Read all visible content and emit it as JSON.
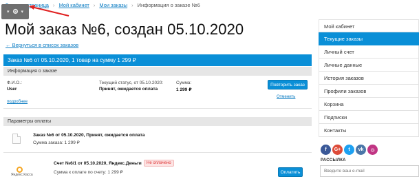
{
  "toolbar": {
    "gear_icon": "gear-icon",
    "caret": "▾"
  },
  "breadcrumb": {
    "items": [
      "Главная страница",
      "Мой кабинет",
      "Мои заказы",
      "Информация о заказе №6"
    ]
  },
  "page_title": "Мой заказ №6, создан 05.10.2020",
  "back_link": "← Вернуться в список заказов",
  "order_bar": "Заказ №6 от 05.10.2020, 1 товар на сумму 1 299 ₽",
  "order_info": {
    "heading": "Информация о заказе",
    "fio_label": "Ф.И.О.:",
    "fio_value": "User",
    "status_label": "Текущий статус, от 05.10.2020:",
    "status_value": "Принят, ожидается оплата",
    "sum_label": "Сумма:",
    "sum_value": "1 299 ₽",
    "repeat_button": "Повторить заказ",
    "cancel_link": "Отменить",
    "details_link": "подробнее"
  },
  "payment": {
    "heading": "Параметры оплаты",
    "order_line": "Заказ №6 от 05.10.2020, Принят, ожидается оплата",
    "order_sum": "Сумма заказа: 1 299 ₽",
    "invoice_title": "Счет №6/1 от 05.10.2020, Яндекс.Деньги",
    "invoice_badge": "Не оплачено",
    "invoice_sum": "Сумма к оплате по счету: 1 299 ₽",
    "pay_button": "Оплатить",
    "yandex_logo_text": "Яндекс.Касса"
  },
  "sidebar": {
    "items": [
      "Мой кабинет",
      "Текущие заказы",
      "Личный счет",
      "Личные данные",
      "История заказов",
      "Профили заказов",
      "Корзина",
      "Подписки",
      "Контакты"
    ],
    "active_index": 1
  },
  "social": [
    {
      "name": "facebook-icon",
      "glyph": "f",
      "color": "#3b5998"
    },
    {
      "name": "google-plus-icon",
      "glyph": "G+",
      "color": "#dd4b39"
    },
    {
      "name": "twitter-icon",
      "glyph": "t",
      "color": "#1da1f2"
    },
    {
      "name": "vk-icon",
      "glyph": "vk",
      "color": "#4a76a8"
    },
    {
      "name": "instagram-icon",
      "glyph": "◎",
      "color": "#c13584"
    }
  ],
  "subscribe": {
    "title": "РАССЫЛКА",
    "placeholder": "Введите ваш e-mail"
  },
  "colors": {
    "accent": "#0a8fd7",
    "link": "#0a7bc2",
    "annotation_arrow": "#e02020"
  }
}
